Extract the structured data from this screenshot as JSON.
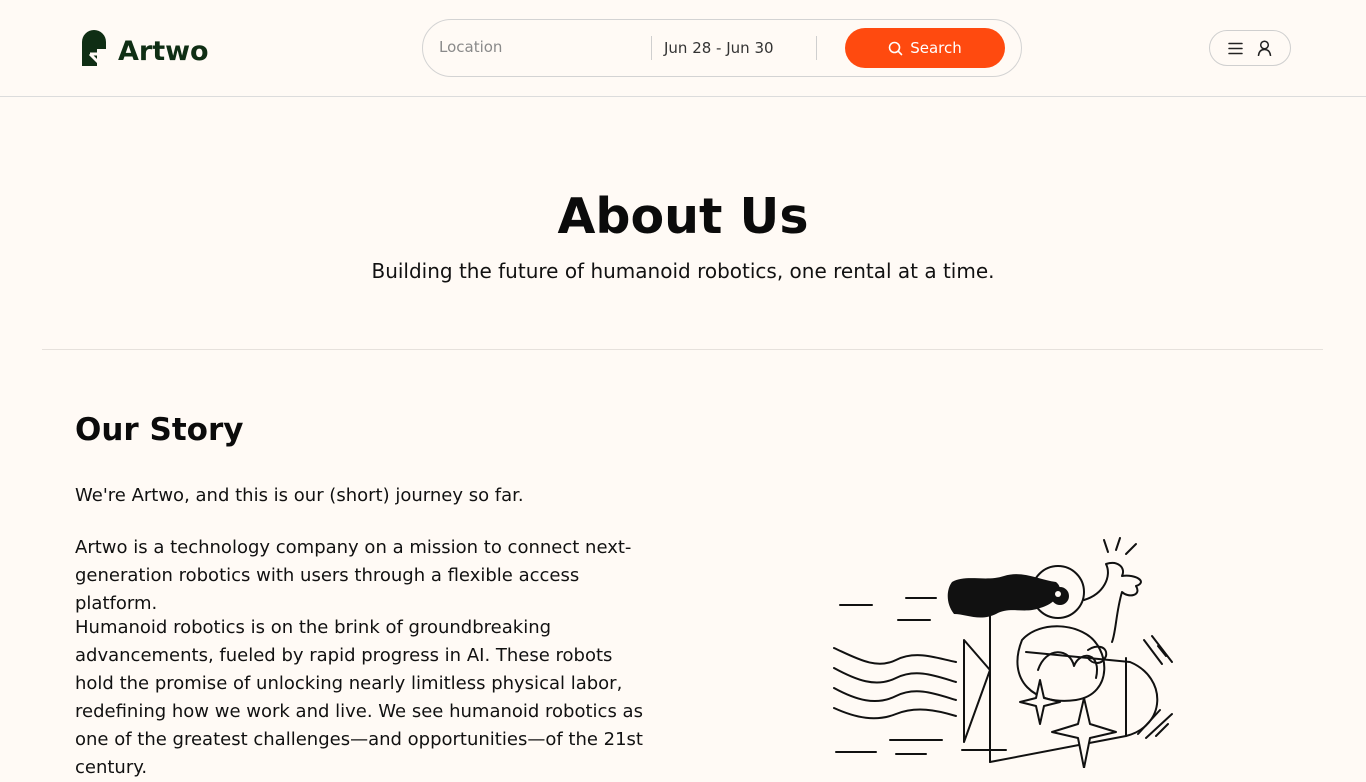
{
  "header": {
    "logo_text": "Artwo",
    "search": {
      "location_placeholder": "Location",
      "location_value": "",
      "dates": "Jun 28 - Jun 30",
      "button_label": "Search"
    }
  },
  "hero": {
    "title": "About Us",
    "subtitle": "Building the future of humanoid robotics, one rental at a time."
  },
  "story": {
    "title": "Our Story",
    "paragraphs": [
      "We're Artwo, and this is our (short) journey so far.",
      "Artwo is a technology company on a mission to connect next-generation robotics with users through a flexible access platform.",
      "Humanoid robotics is on the brink of groundbreaking advancements, fueled by rapid progress in AI. These robots hold the promise of unlocking nearly limitless physical labor, redefining how we work and live. We see humanoid robotics as one of the greatest challenges—and opportunities—of the 21st century."
    ]
  },
  "colors": {
    "background": "#fffaf5",
    "accent": "#ff4a0f",
    "brand": "#0f2e14"
  },
  "icons": {
    "logo": "artwo-logo-icon",
    "search": "search-icon",
    "menu": "hamburger-menu-icon",
    "user": "user-icon"
  }
}
